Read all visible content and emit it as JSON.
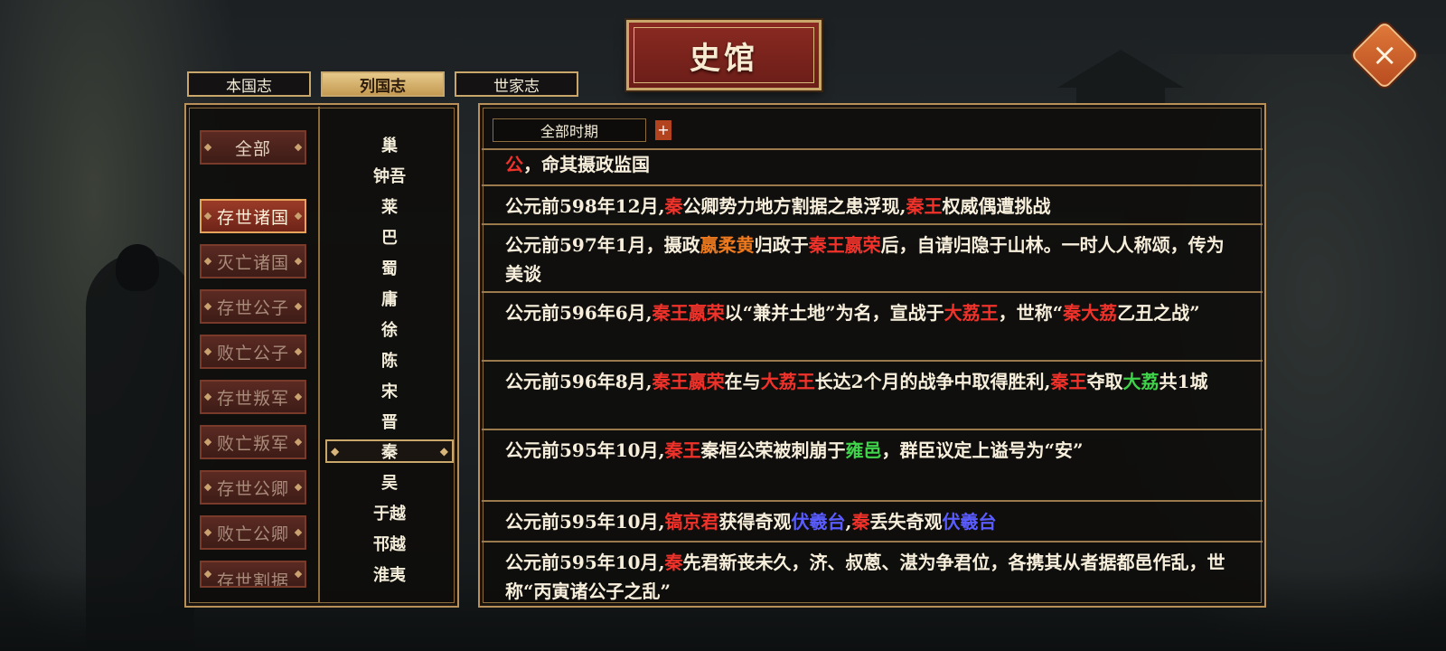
{
  "title": "史馆",
  "tabs": [
    {
      "label": "本国志",
      "active": false
    },
    {
      "label": "列国志",
      "active": true
    },
    {
      "label": "世家志",
      "active": false
    }
  ],
  "categories": [
    "全部",
    "存世诸国",
    "灭亡诸国",
    "存世公子",
    "败亡公子",
    "存世叛军",
    "败亡叛军",
    "存世公卿",
    "败亡公卿",
    "存世割据"
  ],
  "active_category": "存世诸国",
  "states": [
    "巢",
    "钟吾",
    "莱",
    "巴",
    "蜀",
    "庸",
    "徐",
    "陈",
    "宋",
    "晋",
    "秦",
    "吴",
    "于越",
    "邗越",
    "淮夷"
  ],
  "selected_state": "秦",
  "period_filter": "全部时期",
  "period_add": "+",
  "records": [
    [
      {
        "t": "公",
        "c": "red"
      },
      {
        "t": "，命其摄政监国"
      }
    ],
    [
      {
        "t": "公元前598年12月,"
      },
      {
        "t": "秦",
        "c": "red"
      },
      {
        "t": "公卿势力地方割据之患浮现,"
      },
      {
        "t": "秦王",
        "c": "red"
      },
      {
        "t": "权威偶遭挑战"
      }
    ],
    [
      {
        "t": "公元前597年1月，摄政"
      },
      {
        "t": "嬴柔黄",
        "c": "orange"
      },
      {
        "t": "归政于"
      },
      {
        "t": "秦王嬴荣",
        "c": "red"
      },
      {
        "t": "后，自请归隐于山林。一时人人称颂，传为美谈"
      }
    ],
    [
      {
        "t": "公元前596年6月,"
      },
      {
        "t": "秦王嬴荣",
        "c": "red"
      },
      {
        "t": "以“兼并土地”为名，宣战于"
      },
      {
        "t": "大荔王",
        "c": "red"
      },
      {
        "t": "，世称“"
      },
      {
        "t": "秦大荔",
        "c": "red"
      },
      {
        "t": "乙丑之战”"
      }
    ],
    [
      {
        "t": "公元前596年8月,"
      },
      {
        "t": "秦王嬴荣",
        "c": "red"
      },
      {
        "t": "在与"
      },
      {
        "t": "大荔王",
        "c": "red"
      },
      {
        "t": "长达2个月的战争中取得胜利,"
      },
      {
        "t": "秦王",
        "c": "red"
      },
      {
        "t": "夺取"
      },
      {
        "t": "大荔",
        "c": "green"
      },
      {
        "t": "共1城"
      }
    ],
    [
      {
        "t": "公元前595年10月,"
      },
      {
        "t": "秦王",
        "c": "red"
      },
      {
        "t": "秦桓公荣被刺崩于"
      },
      {
        "t": "雍邑",
        "c": "green"
      },
      {
        "t": "，群臣议定上谥号为“安”"
      }
    ],
    [
      {
        "t": "公元前595年10月,"
      },
      {
        "t": "镐京君",
        "c": "red"
      },
      {
        "t": "获得奇观"
      },
      {
        "t": "伏羲台",
        "c": "blue"
      },
      {
        "t": ","
      },
      {
        "t": "秦",
        "c": "red"
      },
      {
        "t": "丢失奇观"
      },
      {
        "t": "伏羲台",
        "c": "blue"
      }
    ],
    [
      {
        "t": "公元前595年10月,"
      },
      {
        "t": "秦",
        "c": "red"
      },
      {
        "t": "先君新丧未久，济、叔蒽、湛为争君位，各携其从者据都邑作乱，世称“丙寅诸公子之乱”"
      }
    ]
  ]
}
